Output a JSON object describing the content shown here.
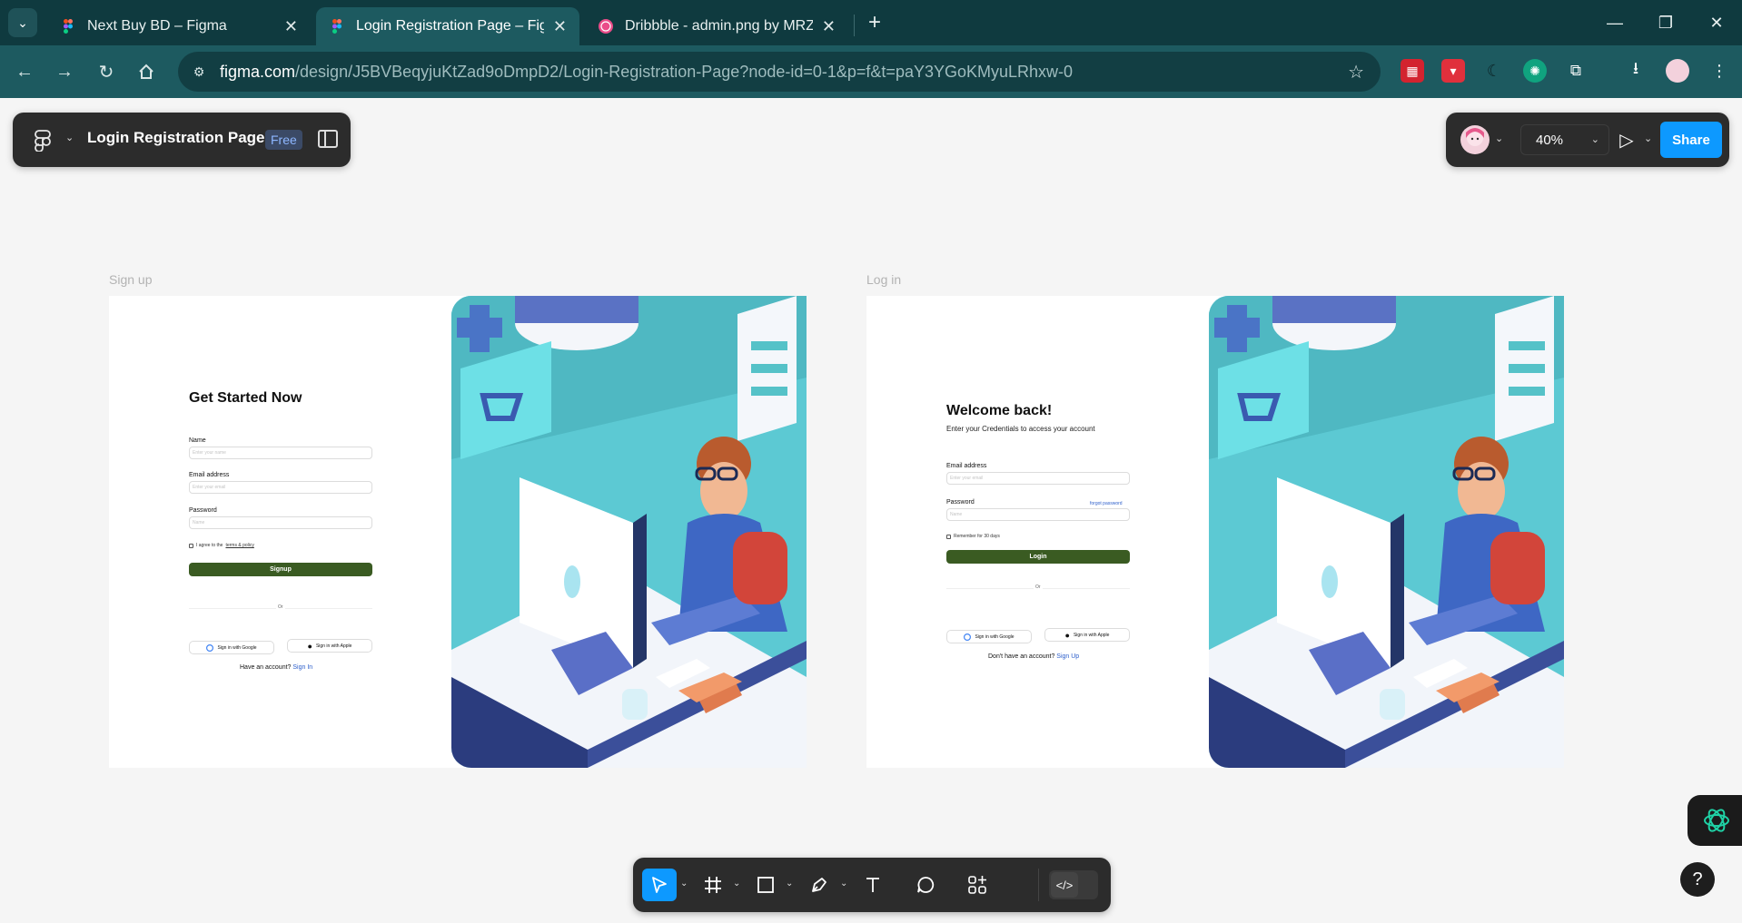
{
  "browser": {
    "tabs": [
      {
        "title": "Next Buy BD – Figma",
        "icon": "figma-icon"
      },
      {
        "title": "Login Registration Page – Figma",
        "icon": "figma-icon"
      },
      {
        "title": "Dribbble - admin.png by MRZ Designer",
        "icon": "dribbble-icon"
      }
    ],
    "url_host": "figma.com",
    "url_path": "/design/J5BVBeqyjuKtZad9oDmpD2/Login-Registration-Page?node-id=0-1&p=f&t=paY3YGoKMyuLRhxw-0",
    "colors": {
      "tabbar": "#0f3a3f",
      "addressbar": "#1d5a60"
    }
  },
  "figma": {
    "file_name": "Login Registration Page",
    "plan_badge": "Free",
    "zoom": "40%",
    "share_label": "Share",
    "accent": "#0d99ff"
  },
  "signup": {
    "frame_label": "Sign up",
    "title": "Get Started Now",
    "name_label": "Name",
    "name_placeholder": "Enter your name",
    "email_label": "Email address",
    "email_placeholder": "Enter your email",
    "password_label": "Password",
    "password_placeholder": "Name",
    "terms_prefix": "I agree to the",
    "terms_link": "terms & policy",
    "button": "Signup",
    "or": "Or",
    "google": "Sign in with Google",
    "apple": "Sign in with Apple",
    "footer_text": "Have an account?",
    "footer_link": "Sign In"
  },
  "login": {
    "frame_label": "Log in",
    "title": "Welcome back!",
    "subtitle": "Enter your Credentials to access your account",
    "email_label": "Email address",
    "email_placeholder": "Enter your email",
    "password_label": "Password",
    "forgot": "forgot password",
    "password_placeholder": "Name",
    "remember": "Remember for 30 days",
    "button": "Login",
    "or": "Or",
    "google": "Sign in with Google",
    "apple": "Sign in with Apple",
    "footer_text": "Don't have an account?",
    "footer_link": "Sign Up",
    "button_color": "#3a5b22"
  }
}
